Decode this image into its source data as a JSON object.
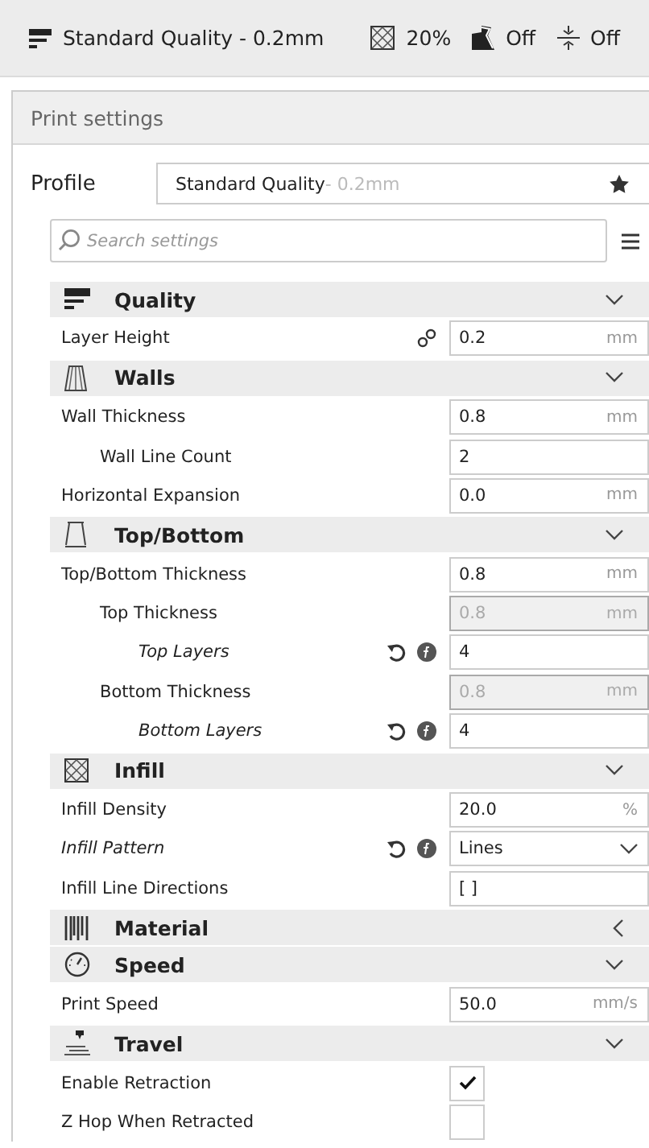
{
  "top_bar": {
    "profile": "Standard Quality - 0.2mm",
    "infill": "20%",
    "support": "Off",
    "adhesion": "Off"
  },
  "panel": {
    "title": "Print settings",
    "profile_label": "Profile",
    "profile_name": "Standard Quality",
    "profile_detail": " - 0.2mm",
    "search_placeholder": "Search settings"
  },
  "sections": [
    {
      "title": "Quality",
      "expanded": true,
      "settings": [
        {
          "label": "Layer Height",
          "linked": true,
          "overridden": false,
          "kind": "field",
          "value": "0.2",
          "unit": "mm",
          "disabled": false
        }
      ]
    },
    {
      "title": "Walls",
      "expanded": true,
      "settings": [
        {
          "label": "Wall Thickness",
          "linked": false,
          "overridden": false,
          "kind": "field",
          "value": "0.8",
          "unit": "mm",
          "disabled": false,
          "children": [
            {
              "label": "Wall Line Count",
              "linked": false,
              "overridden": false,
              "kind": "field",
              "value": "2",
              "disabled": false
            }
          ]
        },
        {
          "label": "Horizontal Expansion",
          "linked": false,
          "overridden": false,
          "kind": "field",
          "value": "0.0",
          "unit": "mm",
          "disabled": false
        }
      ]
    },
    {
      "title": "Top/Bottom",
      "expanded": true,
      "settings": [
        {
          "label": "Top/Bottom Thickness",
          "linked": false,
          "overridden": false,
          "kind": "field",
          "value": "0.8",
          "unit": "mm",
          "disabled": false,
          "children": [
            {
              "label": "Top Thickness",
              "linked": false,
              "overridden": false,
              "kind": "field",
              "value": "0.8",
              "unit": "mm",
              "disabled": true,
              "children": [
                {
                  "label": "Top Layers",
                  "linked": false,
                  "overridden": true,
                  "kind": "field",
                  "value": "4",
                  "disabled": false
                }
              ]
            },
            {
              "label": "Bottom Thickness",
              "linked": false,
              "overridden": false,
              "kind": "field",
              "value": "0.8",
              "unit": "mm",
              "disabled": true,
              "children": [
                {
                  "label": "Bottom Layers",
                  "linked": false,
                  "overridden": true,
                  "kind": "field",
                  "value": "4",
                  "disabled": false
                }
              ]
            }
          ]
        }
      ]
    },
    {
      "title": "Infill",
      "expanded": true,
      "settings": [
        {
          "label": "Infill Density",
          "linked": false,
          "overridden": false,
          "kind": "field",
          "value": "20.0",
          "unit": "%",
          "disabled": false
        },
        {
          "label": "Infill Pattern",
          "linked": false,
          "overridden": true,
          "kind": "select",
          "value": "Lines"
        },
        {
          "label": "Infill Line Directions",
          "linked": false,
          "overridden": false,
          "kind": "field",
          "value": "[ ]",
          "disabled": false
        }
      ]
    },
    {
      "title": "Material",
      "expanded": false
    },
    {
      "title": "Speed",
      "expanded": true,
      "settings": [
        {
          "label": "Print Speed",
          "linked": false,
          "overridden": false,
          "kind": "field",
          "value": "50.0",
          "unit": "mm/s",
          "disabled": false
        }
      ]
    },
    {
      "title": "Travel",
      "expanded": true,
      "settings": [
        {
          "label": "Enable Retraction",
          "linked": false,
          "overridden": false,
          "kind": "checkbox",
          "checked": true
        },
        {
          "label": "Z Hop When Retracted",
          "linked": false,
          "overridden": false,
          "kind": "checkbox",
          "checked": false
        }
      ]
    }
  ]
}
